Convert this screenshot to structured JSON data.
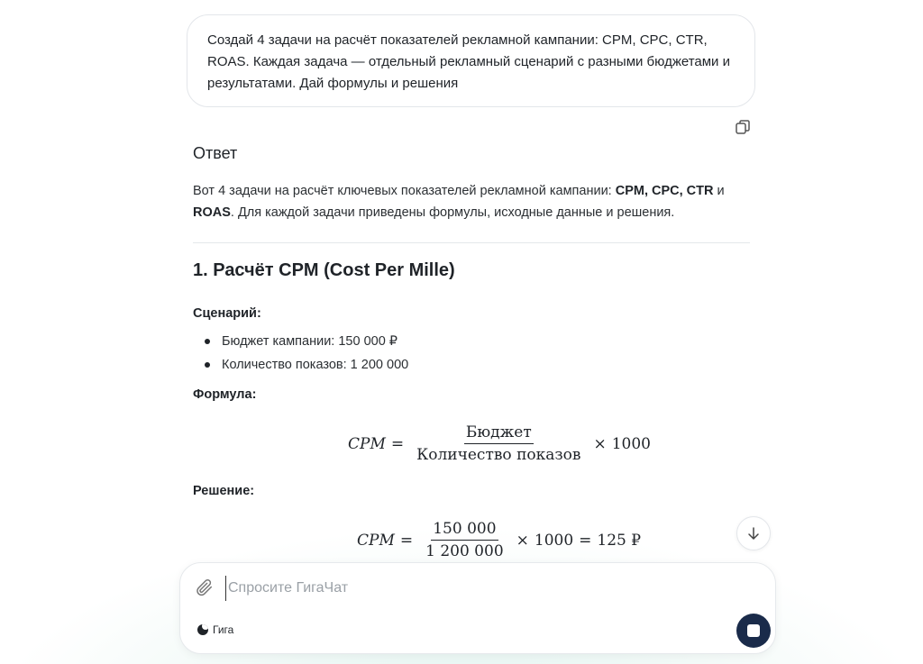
{
  "user_message": {
    "text": "Создай 4 задачи на расчёт показателей рекламной кампании: CPM, CPC, CTR, ROAS. Каждая задача — отдельный рекламный сценарий с разными бюджетами и результатами. Дай формулы и решения"
  },
  "answer": {
    "heading": "Ответ",
    "intro_prefix": "Вот 4 задачи на расчёт ключевых показателей рекламной кампании: ",
    "intro_bold_1": "CPM, CPC, CTR",
    "intro_middle": " и ",
    "intro_bold_2": "ROAS",
    "intro_suffix": ". Для каждой задачи приведены формулы, исходные данные и решения.",
    "section_title": "1. Расчёт CPM (Cost Per Mille)",
    "scenario_label": "Сценарий:",
    "bullets": [
      "Бюджет кампании: 150 000 ₽",
      "Количество показов: 1 200 000"
    ],
    "formula_label": "Формула:",
    "formula": {
      "lhs": "CPM",
      "eq": "=",
      "numerator": "Бюджет",
      "denominator": "Количество показов",
      "times": "×",
      "factor": "1000"
    },
    "solution_label": "Решение:",
    "solution": {
      "lhs": "CPM",
      "eq": "=",
      "numerator": "150 000",
      "denominator": "1 200 000",
      "times": "×",
      "factor": "1000",
      "eq2": "=",
      "result": "125 ₽"
    }
  },
  "composer": {
    "placeholder": "Спросите ГигаЧат",
    "model_name": "Гига"
  },
  "icons": {
    "copy": "copy-icon",
    "scroll_down": "arrow-down-icon",
    "attach": "paperclip-icon",
    "stop": "stop-icon"
  },
  "colors": {
    "stop_button": "#1a2b4a",
    "background_tint": "#dff3ef"
  }
}
